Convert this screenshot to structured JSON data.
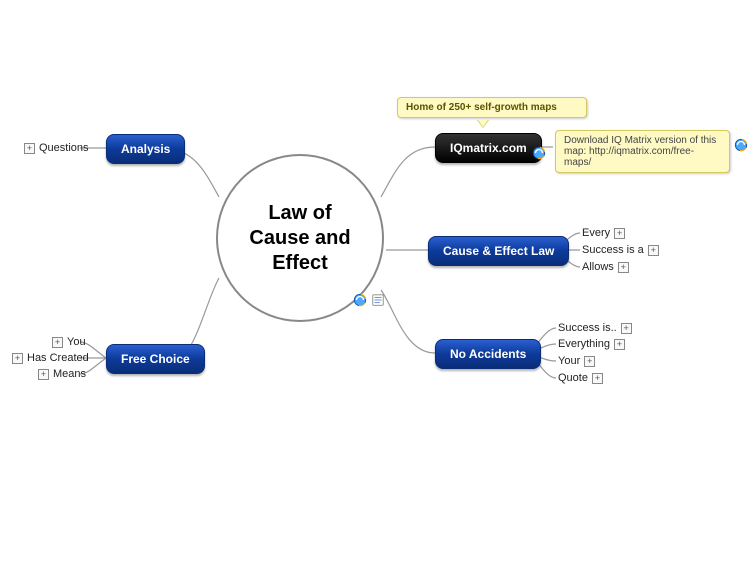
{
  "center": {
    "title_line1": "Law of",
    "title_line2": "Cause and",
    "title_line3": "Effect"
  },
  "branches": {
    "analysis": {
      "label": "Analysis",
      "children": {
        "questions": "Questions"
      }
    },
    "free_choice": {
      "label": "Free Choice",
      "children": {
        "you": "You",
        "has_created": "Has Created",
        "means": "Means"
      }
    },
    "iqmatrix": {
      "label": "IQmatrix.com",
      "callout": "Home of 250+ self-growth maps",
      "download_note": "Download IQ Matrix version of this map: http://iqmatrix.com/free-maps/"
    },
    "cause_effect": {
      "label": "Cause & Effect Law",
      "children": {
        "every": "Every",
        "success_is_a": "Success is a",
        "allows": "Allows"
      }
    },
    "no_accidents": {
      "label": "No Accidents",
      "children": {
        "success_is": "Success is..",
        "everything": "Everything",
        "your": "Your",
        "quote": "Quote"
      }
    }
  }
}
